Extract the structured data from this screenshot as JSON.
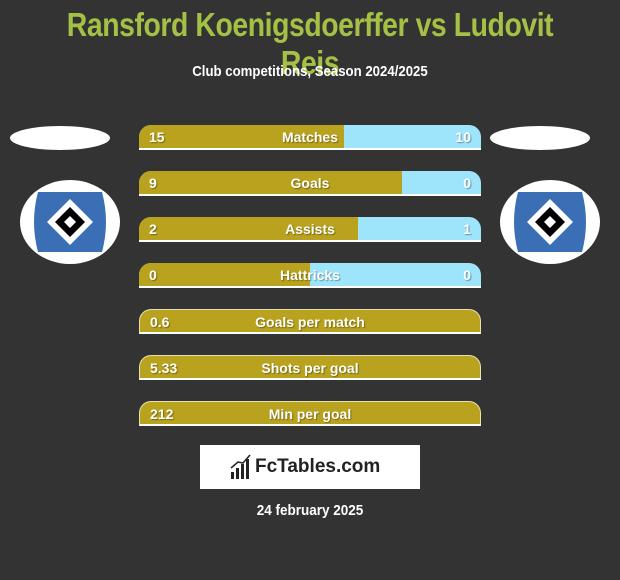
{
  "header": {
    "title": "Ransford Koenigsdoerffer vs Ludovit Reis",
    "subtitle": "Club competitions, Season 2024/2025"
  },
  "players": {
    "left": {
      "name": "Ransford Koenigsdoerffer",
      "club_badge": "hsv-diamond-badge-icon"
    },
    "right": {
      "name": "Ludovit Reis",
      "club_badge": "hsv-diamond-badge-icon"
    }
  },
  "colors": {
    "left_bar": "#b9a21d",
    "right_bar": "#9ee4fb",
    "title": "#a4c045",
    "background": "#333333"
  },
  "stats": [
    {
      "label": "Matches",
      "left": "15",
      "right": "10",
      "left_share": 0.6
    },
    {
      "label": "Goals",
      "left": "9",
      "right": "0",
      "left_share": 0.77
    },
    {
      "label": "Assists",
      "left": "2",
      "right": "1",
      "left_share": 0.64
    },
    {
      "label": "Hattricks",
      "left": "0",
      "right": "0",
      "left_share": 0.5
    },
    {
      "label": "Goals per match",
      "left": "0.6",
      "right": null,
      "left_share": 1
    },
    {
      "label": "Shots per goal",
      "left": "5.33",
      "right": null,
      "left_share": 1
    },
    {
      "label": "Min per goal",
      "left": "212",
      "right": null,
      "left_share": 1
    }
  ],
  "footer": {
    "brand": "FcTables.com",
    "brand_icon": "bar-chart-icon",
    "date": "24 february 2025"
  }
}
